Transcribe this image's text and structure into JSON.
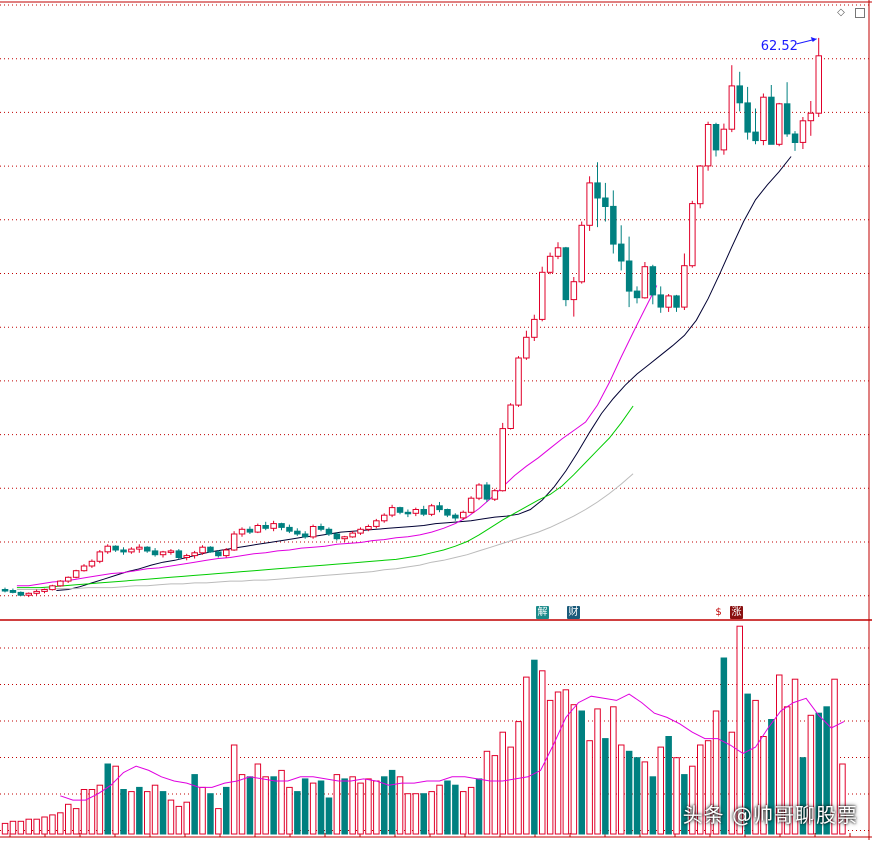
{
  "chart_data": {
    "type": "candlestick",
    "price_annotation": "62.52",
    "ylim": [
      3,
      66
    ],
    "ohlc": [
      [
        3.9,
        4.1,
        3.6,
        3.8
      ],
      [
        3.8,
        4.0,
        3.5,
        3.6
      ],
      [
        3.6,
        3.7,
        3.2,
        3.3
      ],
      [
        3.3,
        3.6,
        3.1,
        3.5
      ],
      [
        3.5,
        3.9,
        3.3,
        3.7
      ],
      [
        3.7,
        4.0,
        3.5,
        3.9
      ],
      [
        3.9,
        4.4,
        3.8,
        4.3
      ],
      [
        4.3,
        4.9,
        4.2,
        4.8
      ],
      [
        4.8,
        5.3,
        4.6,
        5.2
      ],
      [
        5.2,
        6.0,
        5.1,
        5.9
      ],
      [
        5.9,
        6.6,
        5.8,
        6.4
      ],
      [
        6.4,
        7.1,
        6.2,
        6.9
      ],
      [
        6.9,
        8.1,
        6.7,
        7.9
      ],
      [
        7.9,
        8.7,
        7.7,
        8.5
      ],
      [
        8.5,
        8.6,
        7.9,
        8.1
      ],
      [
        8.1,
        8.4,
        7.6,
        7.9
      ],
      [
        7.9,
        8.4,
        7.7,
        8.2
      ],
      [
        8.2,
        8.7,
        7.8,
        8.4
      ],
      [
        8.4,
        8.5,
        7.8,
        8.0
      ],
      [
        8.0,
        8.3,
        7.4,
        7.6
      ],
      [
        7.6,
        8.0,
        7.3,
        7.9
      ],
      [
        7.9,
        8.2,
        7.6,
        8.0
      ],
      [
        8.0,
        8.2,
        7.1,
        7.3
      ],
      [
        7.3,
        7.7,
        7.0,
        7.5
      ],
      [
        7.5,
        8.0,
        7.2,
        7.8
      ],
      [
        7.8,
        8.6,
        7.6,
        8.4
      ],
      [
        8.4,
        8.5,
        7.8,
        7.9
      ],
      [
        7.9,
        8.1,
        7.3,
        7.5
      ],
      [
        7.5,
        8.3,
        7.3,
        8.1
      ],
      [
        8.1,
        10.1,
        8.0,
        9.8
      ],
      [
        9.8,
        10.5,
        9.5,
        10.3
      ],
      [
        10.3,
        10.6,
        9.8,
        10.0
      ],
      [
        10.0,
        10.9,
        9.9,
        10.7
      ],
      [
        10.7,
        11.1,
        10.2,
        10.4
      ],
      [
        10.4,
        11.2,
        10.1,
        10.9
      ],
      [
        10.9,
        11.0,
        10.2,
        10.5
      ],
      [
        10.5,
        10.8,
        9.9,
        10.1
      ],
      [
        10.1,
        10.4,
        9.6,
        9.8
      ],
      [
        9.8,
        10.1,
        9.3,
        9.5
      ],
      [
        9.5,
        10.8,
        9.3,
        10.6
      ],
      [
        10.6,
        10.9,
        10.1,
        10.3
      ],
      [
        10.3,
        10.5,
        9.6,
        9.8
      ],
      [
        9.8,
        10.0,
        9.1,
        9.3
      ],
      [
        9.3,
        9.6,
        9.0,
        9.5
      ],
      [
        9.5,
        10.1,
        9.4,
        9.9
      ],
      [
        9.9,
        10.5,
        9.7,
        10.3
      ],
      [
        10.3,
        10.8,
        10.1,
        10.6
      ],
      [
        10.6,
        11.4,
        10.4,
        11.2
      ],
      [
        11.2,
        12.0,
        11.0,
        11.8
      ],
      [
        11.8,
        12.9,
        11.6,
        12.6
      ],
      [
        12.6,
        12.7,
        11.9,
        12.1
      ],
      [
        12.1,
        12.4,
        11.6,
        12.0
      ],
      [
        12.0,
        12.6,
        11.7,
        12.4
      ],
      [
        12.4,
        12.8,
        11.7,
        11.9
      ],
      [
        11.9,
        13.0,
        11.7,
        12.8
      ],
      [
        12.8,
        13.2,
        12.1,
        12.4
      ],
      [
        12.4,
        12.5,
        11.6,
        11.8
      ],
      [
        11.8,
        12.0,
        11.2,
        11.5
      ],
      [
        11.5,
        12.3,
        11.3,
        12.1
      ],
      [
        12.1,
        13.8,
        12.0,
        13.6
      ],
      [
        13.6,
        15.2,
        13.4,
        15.0
      ],
      [
        15.0,
        15.3,
        13.2,
        13.5
      ],
      [
        13.5,
        14.6,
        13.3,
        14.4
      ],
      [
        14.4,
        21.6,
        14.3,
        21.0
      ],
      [
        21.0,
        23.7,
        20.9,
        23.5
      ],
      [
        23.5,
        28.7,
        23.3,
        28.5
      ],
      [
        28.5,
        31.4,
        28.3,
        30.7
      ],
      [
        30.7,
        33.1,
        30.3,
        32.6
      ],
      [
        32.6,
        38.2,
        32.4,
        37.6
      ],
      [
        37.6,
        39.7,
        37.4,
        39.3
      ],
      [
        39.3,
        40.8,
        39.0,
        40.2
      ],
      [
        40.2,
        40.3,
        34.0,
        34.7
      ],
      [
        34.7,
        37.1,
        32.9,
        36.6
      ],
      [
        36.6,
        43.0,
        36.4,
        42.6
      ],
      [
        42.6,
        47.8,
        42.0,
        47.1
      ],
      [
        47.1,
        49.3,
        42.4,
        45.5
      ],
      [
        45.5,
        47.1,
        43.0,
        44.6
      ],
      [
        44.6,
        46.3,
        39.6,
        40.6
      ],
      [
        40.6,
        42.6,
        37.8,
        38.8
      ],
      [
        38.8,
        41.4,
        33.9,
        35.6
      ],
      [
        35.6,
        36.1,
        34.3,
        34.9
      ],
      [
        34.9,
        38.7,
        34.8,
        38.2
      ],
      [
        38.2,
        38.4,
        34.2,
        35.2
      ],
      [
        35.2,
        36.1,
        33.3,
        33.9
      ],
      [
        33.9,
        35.3,
        33.4,
        35.1
      ],
      [
        35.1,
        35.2,
        33.4,
        33.9
      ],
      [
        33.9,
        39.6,
        33.6,
        38.3
      ],
      [
        38.3,
        45.2,
        38.1,
        44.9
      ],
      [
        44.9,
        49.0,
        44.4,
        48.9
      ],
      [
        48.9,
        53.6,
        48.4,
        53.3
      ],
      [
        53.3,
        53.5,
        49.9,
        50.6
      ],
      [
        50.6,
        53.4,
        50.1,
        52.8
      ],
      [
        52.8,
        59.6,
        52.5,
        57.4
      ],
      [
        57.4,
        58.9,
        54.7,
        55.6
      ],
      [
        55.6,
        57.3,
        51.7,
        52.5
      ],
      [
        52.5,
        55.0,
        51.2,
        51.6
      ],
      [
        51.6,
        56.6,
        51.1,
        56.2
      ],
      [
        56.2,
        57.5,
        51.2,
        51.2
      ],
      [
        51.2,
        55.6,
        51.0,
        55.5
      ],
      [
        55.5,
        57.8,
        52.0,
        52.3
      ],
      [
        52.3,
        52.6,
        50.5,
        51.4
      ],
      [
        51.4,
        54.1,
        50.7,
        53.7
      ],
      [
        53.7,
        55.8,
        52.1,
        54.5
      ],
      [
        54.5,
        62.5,
        54.1,
        60.6
      ]
    ],
    "ma_lines": [
      {
        "color": "#000033",
        "start": 6.5,
        "values": [
          3.8,
          3.9,
          4.2,
          4.6,
          5.0,
          5.4,
          5.8,
          6.1,
          6.5,
          6.8,
          7.0,
          7.3,
          7.6,
          7.9,
          8.1,
          8.3,
          8.5,
          8.7,
          8.9,
          9.1,
          9.3,
          9.5,
          9.6,
          9.8,
          10.0,
          10.1,
          10.2,
          10.3,
          10.4,
          10.5,
          10.6,
          10.7,
          10.9,
          11.0,
          11.1,
          11.2,
          11.4,
          11.6,
          11.7,
          11.9,
          12.4,
          13.4,
          14.8,
          16.5,
          18.5,
          20.6,
          22.6,
          24.2,
          25.6,
          26.8,
          27.8,
          28.8,
          29.8,
          30.9,
          32.5,
          34.8,
          37.5,
          40.3,
          43.0,
          45.3,
          46.9,
          48.3,
          49.9
        ]
      },
      {
        "color": "#e000e0",
        "start": 1.5,
        "values": [
          4.3,
          4.3,
          4.5,
          4.7,
          4.8,
          5.0,
          5.2,
          5.4,
          5.6,
          5.7,
          5.9,
          6.1,
          6.2,
          6.4,
          6.6,
          6.8,
          7.0,
          7.2,
          7.3,
          7.5,
          7.7,
          7.8,
          8.0,
          8.1,
          8.3,
          8.4,
          8.5,
          8.7,
          8.8,
          8.9,
          9.1,
          9.2,
          9.4,
          9.5,
          9.7,
          10.0,
          10.4,
          10.9,
          11.6,
          12.5,
          13.6,
          14.8,
          16.0,
          17.0,
          17.9,
          18.9,
          19.9,
          20.8,
          21.7,
          23.5,
          25.9,
          28.6,
          31.2,
          33.7,
          36.2
        ]
      },
      {
        "color": "#00cc00",
        "start": 1.5,
        "values": [
          4.1,
          4.1,
          4.1,
          4.2,
          4.3,
          4.4,
          4.5,
          4.6,
          4.7,
          4.8,
          4.9,
          5.0,
          5.1,
          5.2,
          5.3,
          5.4,
          5.5,
          5.6,
          5.7,
          5.8,
          5.9,
          6.0,
          6.1,
          6.2,
          6.3,
          6.4,
          6.5,
          6.6,
          6.7,
          6.8,
          6.9,
          7.0,
          7.1,
          7.3,
          7.5,
          7.8,
          8.1,
          8.5,
          9.0,
          9.7,
          10.5,
          11.3,
          12.0,
          12.7,
          13.4,
          14.0,
          14.9,
          16.1,
          17.4,
          18.7,
          20.0,
          21.6,
          23.4
        ]
      },
      {
        "color": "#bbbbbb",
        "start": 1.5,
        "values": [
          3.9,
          3.9,
          3.9,
          4.0,
          4.0,
          4.0,
          4.1,
          4.1,
          4.1,
          4.2,
          4.3,
          4.3,
          4.4,
          4.5,
          4.5,
          4.6,
          4.6,
          4.7,
          4.8,
          4.8,
          4.9,
          4.9,
          5.0,
          5.1,
          5.2,
          5.3,
          5.4,
          5.5,
          5.6,
          5.7,
          5.8,
          6.0,
          6.1,
          6.3,
          6.5,
          6.8,
          7.0,
          7.3,
          7.6,
          8.0,
          8.4,
          8.8,
          9.2,
          9.6,
          10.0,
          10.5,
          11.1,
          11.7,
          12.4,
          13.2,
          14.1,
          15.1,
          16.2
        ]
      }
    ],
    "volume": {
      "ylim": [
        0,
        100
      ],
      "values": [
        5,
        6,
        6,
        7,
        7,
        8,
        9,
        10,
        14,
        12,
        21,
        21,
        23,
        33,
        32,
        21,
        20,
        22,
        20,
        23,
        20,
        16,
        13,
        15,
        28,
        22,
        19,
        12,
        22,
        42,
        28,
        27,
        33,
        27,
        27,
        30,
        22,
        20,
        26,
        24,
        25,
        17,
        28,
        26,
        27,
        24,
        26,
        25,
        27,
        30,
        27,
        19,
        19,
        19,
        20,
        23,
        25,
        23,
        20,
        22,
        26,
        39,
        37,
        48,
        41,
        53,
        74,
        82,
        77,
        63,
        67,
        68,
        61,
        58,
        44,
        59,
        45,
        60,
        42,
        39,
        36,
        34,
        27,
        41,
        46,
        36,
        28,
        32,
        42,
        44,
        58,
        83,
        48,
        98,
        66,
        63,
        46,
        54,
        75,
        60,
        73,
        36,
        56,
        57,
        60,
        73,
        33
      ],
      "colors": "rrrrrrrrrrrrrtrtrtrrtrrrtrtrtrrtrrtrrttrttrtrrrrttrrrtrrttrrtrrrrrrtrrrrrtrrtrrttrtrtrtrrrrtrrtrrtrrrtrttrrr",
      "ma_values": [
        18,
        16,
        16,
        19,
        23,
        29,
        32,
        30,
        27,
        25,
        24,
        22,
        22,
        24,
        25,
        27,
        26,
        25,
        25,
        27,
        27,
        26,
        25,
        25,
        26,
        25,
        23,
        24,
        24,
        25,
        25,
        27,
        27,
        26,
        25,
        25,
        26,
        27,
        30,
        42,
        55,
        62,
        65,
        64,
        63,
        66,
        62,
        57,
        55,
        52,
        48,
        45,
        45,
        42,
        38,
        41,
        50,
        58,
        62,
        64,
        56,
        50,
        53
      ]
    },
    "badges": [
      {
        "label": "解",
        "bg": "#1a8a8a"
      },
      {
        "label": "财",
        "bg": "#1a5a7a"
      },
      {
        "label": "$",
        "bg": "#ffffff"
      },
      {
        "label": "涨",
        "bg": "#8a1010"
      }
    ],
    "colors": {
      "up": "#e0002a",
      "down": "#008080",
      "grid": "#c00000",
      "frame": "#c00000"
    }
  },
  "watermark": "头条 @帅哥聊股票"
}
